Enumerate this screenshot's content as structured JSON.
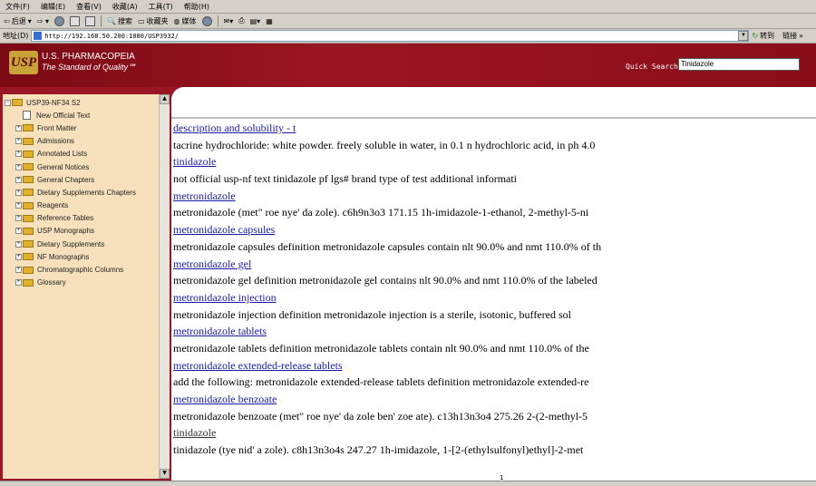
{
  "menu": [
    "文件(F)",
    "编辑(E)",
    "查看(V)",
    "收藏(A)",
    "工具(T)",
    "帮助(H)"
  ],
  "toolbar": {
    "back": "后退",
    "search": "搜索",
    "favorites": "收藏夹",
    "media": "媒体"
  },
  "address": {
    "label": "地址(D)",
    "url": "http://192.168.50.200:1080/USP3932/",
    "go": "转到",
    "links": "链接"
  },
  "banner": {
    "logo": "USP",
    "title": "U.S. PHARMACOPEIA",
    "tagline": "The Standard of Quality℠",
    "quick_search_label": "Quick Search",
    "quick_search_value": "Tinidazole"
  },
  "tree": {
    "root": "USP39-NF34 S2",
    "items": [
      "New Official Text",
      "Front Matter",
      "Admissions",
      "Annotated Lists",
      "General Notices",
      "General Chapters",
      "Dietary Supplements Chapters",
      "Reagents",
      "Reference Tables",
      "USP Monographs",
      "Dietary Supplements",
      "NF Monographs",
      "Chromatographic Columns",
      "Glossary"
    ]
  },
  "results": [
    {
      "title": "description and solubility - t",
      "snippet": "tacrine hydrochloride: white powder. freely soluble in water, in 0.1 n hydrochloric acid, in ph 4.0"
    },
    {
      "title": "tinidazole",
      "snippet": "not official usp-nf text tinidazole pf lgs# brand type of test additional informati"
    },
    {
      "title": "metronidazole",
      "snippet": "metronidazole (met\" roe nye' da zole). c6h9n3o3 171.15 1h-imidazole-1-ethanol, 2-methyl-5-ni"
    },
    {
      "title": "metronidazole capsules",
      "snippet": "metronidazole capsules definition metronidazole capsules contain nlt 90.0% and nmt 110.0% of th"
    },
    {
      "title": "metronidazole gel",
      "snippet": "metronidazole gel definition metronidazole gel contains nlt 90.0% and nmt 110.0% of the labeled"
    },
    {
      "title": "metronidazole injection",
      "snippet": "metronidazole injection definition metronidazole injection is a sterile, isotonic, buffered sol"
    },
    {
      "title": "metronidazole tablets",
      "snippet": "metronidazole tablets definition metronidazole tablets contain nlt 90.0% and nmt 110.0% of the"
    },
    {
      "title": "metronidazole extended-release tablets",
      "snippet": "add the following: metronidazole extended-release tablets definition metronidazole extended-re"
    },
    {
      "title": "metronidazole benzoate",
      "snippet": "metronidazole benzoate (met\" roe nye' da zole ben' zoe ate). c13h13n3o4 275.26 2-(2-methyl-5"
    },
    {
      "title": "tinidazole",
      "snippet": "tinidazole (tye nid' a zole). c8h13n3o4s 247.27 1h-imidazole, 1-[2-(ethylsulfonyl)ethyl]-2-met",
      "visited": true
    }
  ],
  "page_number": "1"
}
